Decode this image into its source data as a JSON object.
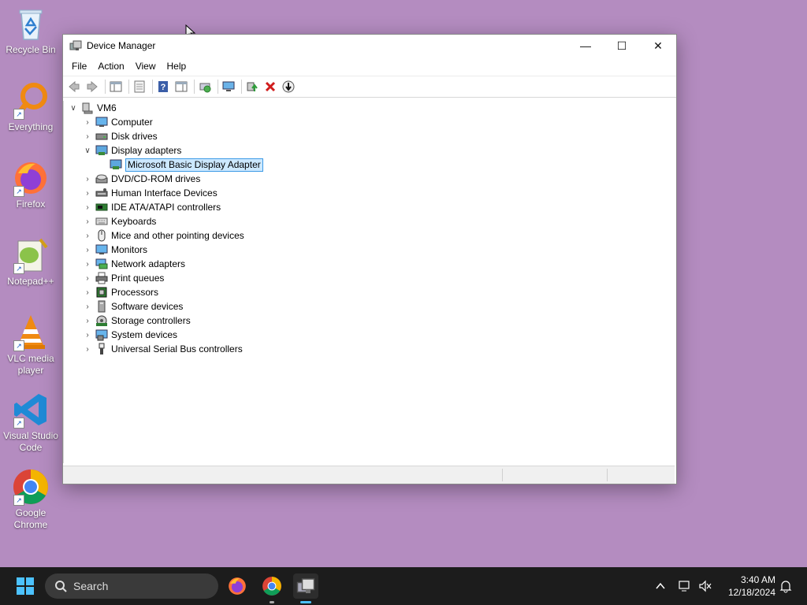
{
  "desktop": {
    "icons": [
      {
        "label": "Recycle Bin"
      },
      {
        "label": "Everything"
      },
      {
        "label": "Firefox"
      },
      {
        "label": "Notepad++"
      },
      {
        "label": "VLC media player"
      },
      {
        "label": "Visual Studio Code"
      },
      {
        "label": "Google Chrome"
      }
    ]
  },
  "window": {
    "title": "Device Manager",
    "controls": {
      "minimize": "—",
      "maximize": "☐",
      "close": "✕"
    }
  },
  "menu": [
    "File",
    "Action",
    "View",
    "Help"
  ],
  "toolbar": [
    "back-icon",
    "forward-icon",
    "show-hide-console-tree-icon",
    "properties-icon",
    "help-icon",
    "action-pane-icon",
    "scan-hardware-icon",
    "monitor-icon",
    "update-driver-icon",
    "uninstall-icon",
    "disable-icon"
  ],
  "tree": {
    "root": "VM6",
    "items": [
      {
        "label": "Computer",
        "icon": "computer-icon",
        "expanded": false
      },
      {
        "label": "Disk drives",
        "icon": "disk-drive-icon",
        "expanded": false
      },
      {
        "label": "Display adapters",
        "icon": "display-adapter-icon",
        "expanded": true,
        "children": [
          {
            "label": "Microsoft Basic Display Adapter",
            "icon": "display-adapter-icon",
            "selected": true
          }
        ]
      },
      {
        "label": "DVD/CD-ROM drives",
        "icon": "dvd-icon",
        "expanded": false
      },
      {
        "label": "Human Interface Devices",
        "icon": "hid-icon",
        "expanded": false
      },
      {
        "label": "IDE ATA/ATAPI controllers",
        "icon": "ide-icon",
        "expanded": false
      },
      {
        "label": "Keyboards",
        "icon": "keyboard-icon",
        "expanded": false
      },
      {
        "label": "Mice and other pointing devices",
        "icon": "mouse-icon",
        "expanded": false
      },
      {
        "label": "Monitors",
        "icon": "monitor-icon",
        "expanded": false
      },
      {
        "label": "Network adapters",
        "icon": "network-icon",
        "expanded": false
      },
      {
        "label": "Print queues",
        "icon": "printer-icon",
        "expanded": false
      },
      {
        "label": "Processors",
        "icon": "processor-icon",
        "expanded": false
      },
      {
        "label": "Software devices",
        "icon": "software-device-icon",
        "expanded": false
      },
      {
        "label": "Storage controllers",
        "icon": "storage-icon",
        "expanded": false
      },
      {
        "label": "System devices",
        "icon": "system-device-icon",
        "expanded": false
      },
      {
        "label": "Universal Serial Bus controllers",
        "icon": "usb-icon",
        "expanded": false
      }
    ]
  },
  "taskbar": {
    "search_placeholder": "Search",
    "time": "3:40 AM",
    "date": "12/18/2024"
  },
  "colors": {
    "desktop": "#b48cc0",
    "selection": "#cce8ff",
    "selection_border": "#3c9be6",
    "taskbar": "#1c1c1c"
  }
}
